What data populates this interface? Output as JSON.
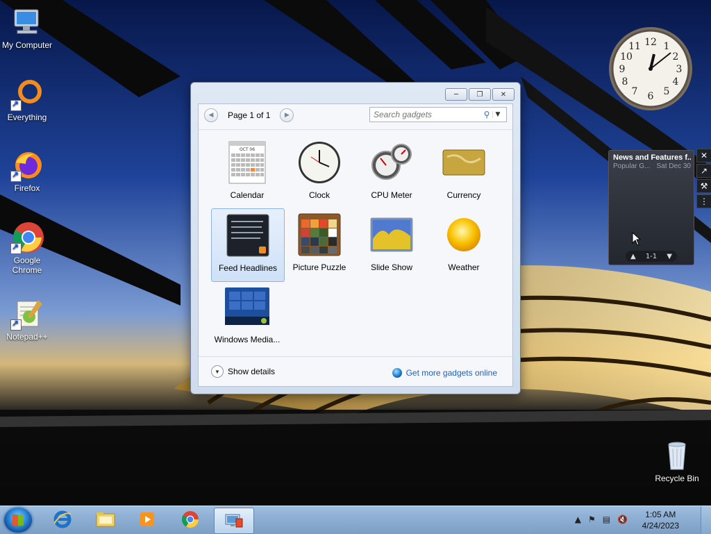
{
  "desktop": {
    "icons": [
      {
        "label": "My Computer",
        "icon": "my-computer-icon"
      },
      {
        "label": "Everything",
        "icon": "everything-icon"
      },
      {
        "label": "Firefox",
        "icon": "firefox-icon"
      },
      {
        "label": "Google Chrome",
        "icon": "chrome-icon"
      },
      {
        "label": "Notepad++",
        "icon": "notepad-plus-plus-icon"
      },
      {
        "label": "Recycle Bin",
        "icon": "recycle-bin-icon"
      }
    ]
  },
  "gadget_window": {
    "pager_text": "Page 1 of 1",
    "search_placeholder": "Search gadgets",
    "gadgets": [
      {
        "label": "Calendar",
        "icon": "calendar-gadget-icon"
      },
      {
        "label": "Clock",
        "icon": "clock-gadget-icon"
      },
      {
        "label": "CPU Meter",
        "icon": "cpu-meter-gadget-icon"
      },
      {
        "label": "Currency",
        "icon": "currency-gadget-icon"
      },
      {
        "label": "Feed Headlines",
        "icon": "feed-headlines-gadget-icon",
        "selected": true
      },
      {
        "label": "Picture Puzzle",
        "icon": "picture-puzzle-gadget-icon"
      },
      {
        "label": "Slide Show",
        "icon": "slide-show-gadget-icon"
      },
      {
        "label": "Weather",
        "icon": "weather-gadget-icon"
      },
      {
        "label": "Windows Media...",
        "icon": "windows-media-gadget-icon"
      }
    ],
    "calendar_month": "OCT 06",
    "show_details": "Show details",
    "get_more": "Get more gadgets online"
  },
  "feed_gadget": {
    "title": "News and Features f...",
    "source": "Popular G...",
    "date": "Sat Dec 30",
    "pager": "1-1"
  },
  "taskbar": {
    "time": "1:05 AM",
    "date": "4/24/2023"
  },
  "colors": {
    "link": "#1f5fbf",
    "selection": "#cfe1f8"
  }
}
